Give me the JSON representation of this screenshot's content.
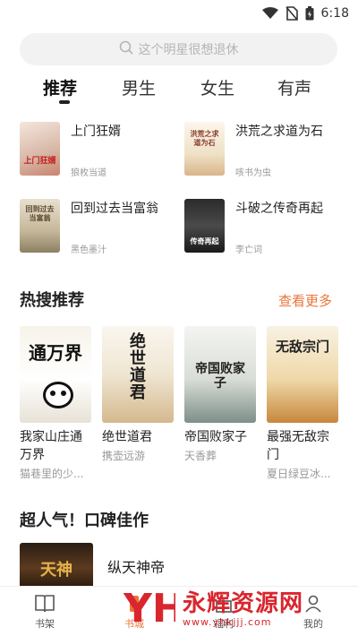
{
  "status": {
    "time": "6:18"
  },
  "search": {
    "placeholder": "这个明星很想退休"
  },
  "tabs": [
    "推荐",
    "男生",
    "女生",
    "有声"
  ],
  "top_books": [
    {
      "title": "上门狂婿",
      "author": "狼枚当道",
      "cover_text": "上门狂婿"
    },
    {
      "title": "洪荒之求道为石",
      "author": "咳书为虫",
      "cover_text": "洪荒之求道为石"
    },
    {
      "title": "回到过去当富翁",
      "author": "黑色墨汁",
      "cover_text": "回到过去当富翁"
    },
    {
      "title": "斗破之传奇再起",
      "author": "李亡词",
      "cover_text": "传奇再起"
    }
  ],
  "hot_section": {
    "title": "热搜推荐",
    "more": "查看更多"
  },
  "hot_books": [
    {
      "title": "我家山庄通万界",
      "author": "猫巷里的少...",
      "cover_text": "通万界"
    },
    {
      "title": "绝世道君",
      "author": "携壶远游",
      "cover_text": "绝世道君"
    },
    {
      "title": "帝国败家子",
      "author": "天香葬",
      "cover_text": "帝国败家子"
    },
    {
      "title": "最强无敌宗门",
      "author": "夏日绿豆冰...",
      "cover_text": "无敌宗门"
    }
  ],
  "popular_section": {
    "title": "超人气！口碑佳作"
  },
  "popular_books": [
    {
      "title": "纵天神帝",
      "cover_text": "天神"
    }
  ],
  "bottom_nav": [
    {
      "label": "书架",
      "icon": "book-icon"
    },
    {
      "label": "书城",
      "icon": "store-icon"
    },
    {
      "label": "福利",
      "icon": "gift-icon"
    },
    {
      "label": "我的",
      "icon": "user-icon"
    }
  ],
  "watermark": {
    "text": "永辉资源网",
    "url": "www.yhkjjj.com",
    "logo": "YH"
  },
  "colors": {
    "accent": "#e8753a",
    "watermark": "#d9262e"
  }
}
